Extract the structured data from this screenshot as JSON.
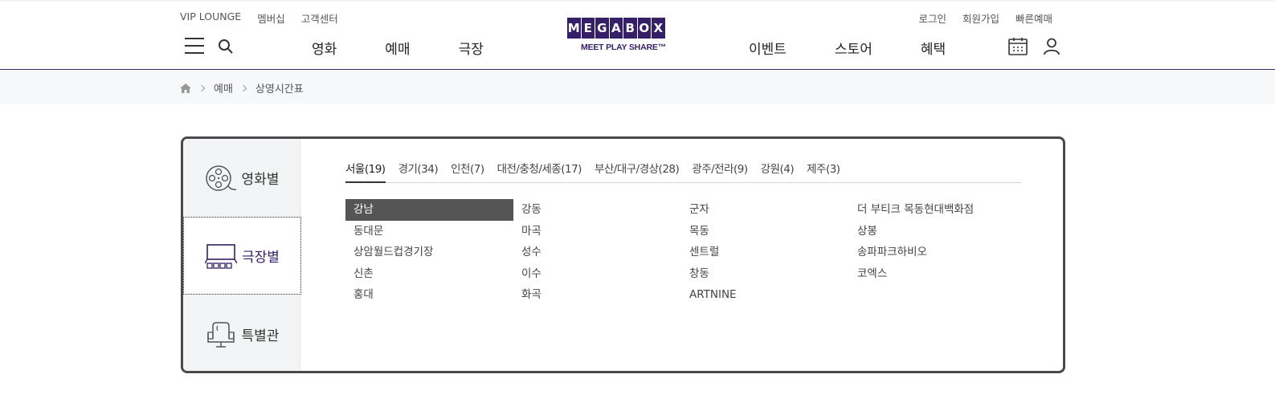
{
  "util_left": [
    "VIP LOUNGE",
    "멤버십",
    "고객센터"
  ],
  "util_right": [
    "로그인",
    "회원가입",
    "빠른예매"
  ],
  "gnb_left": [
    "영화",
    "예매",
    "극장"
  ],
  "gnb_right": [
    "이벤트",
    "스토어",
    "혜택"
  ],
  "logo": {
    "letters": [
      "M",
      "E",
      "G",
      "A",
      "B",
      "O",
      "X"
    ],
    "tagline": "MEET PLAY SHARE™",
    "color": "#351f66"
  },
  "breadcrumb": {
    "home_icon": "home-icon",
    "items": [
      "예매",
      "상영시간표"
    ]
  },
  "side_tabs": [
    {
      "label": "영화별",
      "icon": "film-reel-icon"
    },
    {
      "label": "극장별",
      "icon": "theater-screen-icon"
    },
    {
      "label": "특별관",
      "icon": "recliner-seat-icon"
    }
  ],
  "region_tabs": [
    "서울(19)",
    "경기(34)",
    "인천(7)",
    "대전/충청/세종(17)",
    "부산/대구/경상(28)",
    "광주/전라(9)",
    "강원(4)",
    "제주(3)"
  ],
  "theaters": [
    "강남",
    "강동",
    "군자",
    "더 부티크 목동현대백화점",
    "동대문",
    "마곡",
    "목동",
    "상봉",
    "상암월드컵경기장",
    "성수",
    "센트럴",
    "송파파크하비오",
    "신촌",
    "이수",
    "창동",
    "코엑스",
    "홍대",
    "화곡",
    "ARTNINE"
  ],
  "selected_theater": "강남",
  "colors": {
    "brand": "#351f66",
    "selected_cell": "#555555"
  }
}
